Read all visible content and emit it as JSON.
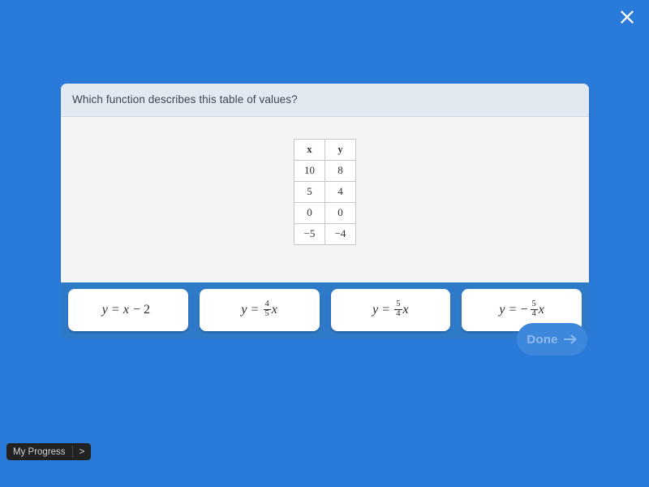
{
  "close": {
    "icon": "close-icon"
  },
  "question": {
    "text": "Which function describes this table of values?"
  },
  "table": {
    "headers": [
      "x",
      "y"
    ],
    "rows": [
      [
        "10",
        "8"
      ],
      [
        "5",
        "4"
      ],
      [
        "0",
        "0"
      ],
      [
        "−5",
        "−4"
      ]
    ]
  },
  "choices": [
    {
      "id": "choice-1",
      "text": "y = x − 2",
      "lhs": "y",
      "eq": "=",
      "negative": "",
      "fraction": null,
      "rhs_var": "x",
      "tail": "− 2"
    },
    {
      "id": "choice-2",
      "text": "y = 4/5 x",
      "lhs": "y",
      "eq": "=",
      "negative": "",
      "fraction": {
        "numerator": "4",
        "denominator": "5"
      },
      "rhs_var": "x",
      "tail": ""
    },
    {
      "id": "choice-3",
      "text": "y = 5/4 x",
      "lhs": "y",
      "eq": "=",
      "negative": "",
      "fraction": {
        "numerator": "5",
        "denominator": "4"
      },
      "rhs_var": "x",
      "tail": ""
    },
    {
      "id": "choice-4",
      "text": "y = − 5/4 x",
      "lhs": "y",
      "eq": "=",
      "negative": "−",
      "fraction": {
        "numerator": "5",
        "denominator": "4"
      },
      "rhs_var": "x",
      "tail": ""
    }
  ],
  "done": {
    "label": "Done",
    "icon": "arrow-right-icon",
    "enabled": false
  },
  "progress": {
    "label": "My Progress",
    "toggle": ">"
  },
  "colors": {
    "background": "#2a7ad9",
    "panel": "#2f79c9",
    "header": "#e3e9f0",
    "body": "#f4f4f4",
    "done_fill": "#3d87dd",
    "done_text": "#8fbbec",
    "progress_bg": "#222222"
  }
}
